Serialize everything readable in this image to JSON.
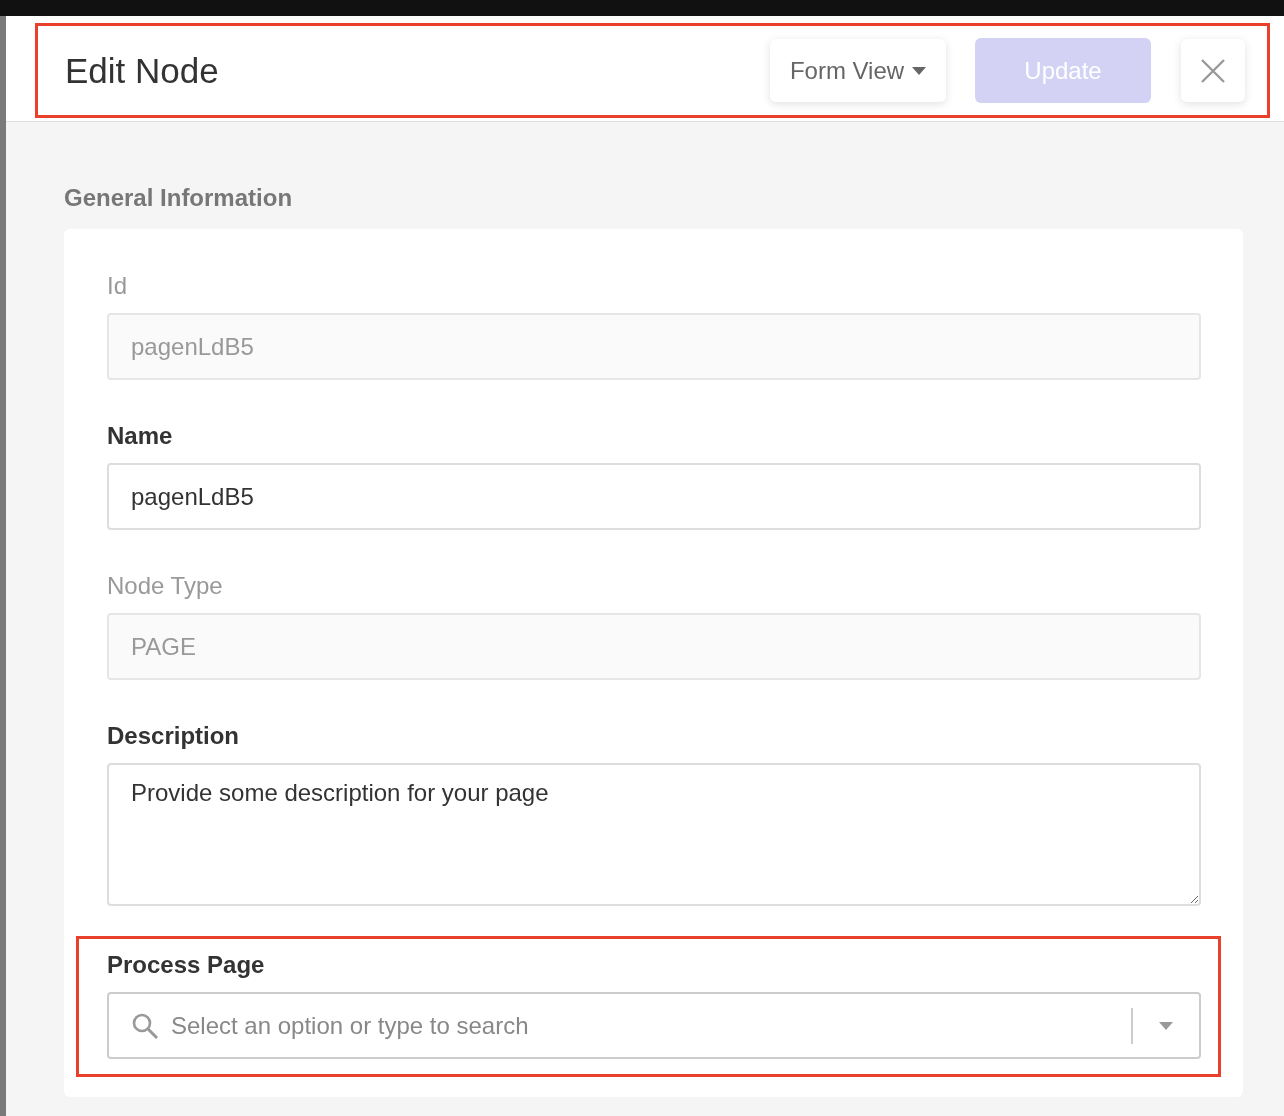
{
  "header": {
    "title": "Edit Node",
    "highlighted": true,
    "view_button": {
      "label": "Form View"
    },
    "update_button": {
      "label": "Update",
      "disabled": true
    }
  },
  "section": {
    "title": "General Information"
  },
  "fields": [
    {
      "kind": "text",
      "label": "Id",
      "value": "pagenLdB5",
      "disabled": true,
      "highlighted": false
    },
    {
      "kind": "text",
      "label": "Name",
      "value": "pagenLdB5",
      "disabled": false,
      "highlighted": false
    },
    {
      "kind": "text",
      "label": "Node Type",
      "value": "PAGE",
      "disabled": true,
      "highlighted": false
    },
    {
      "kind": "textarea",
      "label": "Description",
      "value": "Provide some description for your page",
      "disabled": false,
      "highlighted": false
    },
    {
      "kind": "select",
      "label": "Process Page",
      "placeholder": "Select an option or type to search",
      "disabled": false,
      "highlighted": true
    }
  ]
}
